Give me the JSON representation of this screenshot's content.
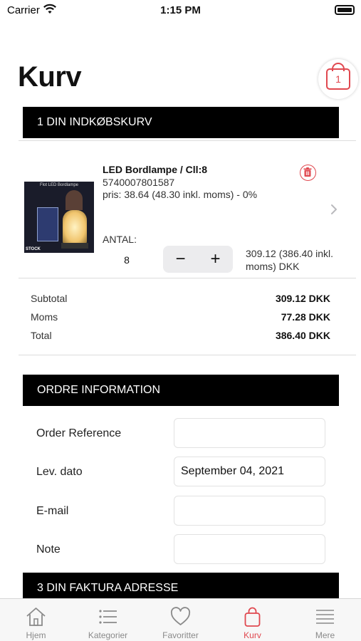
{
  "status_bar": {
    "carrier": "Carrier",
    "time": "1:15 PM"
  },
  "header": {
    "title": "Kurv",
    "cart_count": "1"
  },
  "cart_section": {
    "title": "1  DIN INDKØBSKURV"
  },
  "product": {
    "name": "LED Bordlampe / Cll:8",
    "sku": "5740007801587",
    "price": "pris: 38.64 (48.30 inkl. moms)  -  0%",
    "image_caption": "Flot LED Bordlampe",
    "image_watermark": "STOCK",
    "quantity_label": "ANTAL:",
    "quantity": "8",
    "line_total_line1": "309.12 (386.40 inkl.",
    "line_total_line2": "moms) DKK"
  },
  "totals": {
    "subtotal_label": "Subtotal",
    "subtotal_value": "309.12 DKK",
    "moms_label": "Moms",
    "moms_value": "77.28 DKK",
    "total_label": "Total",
    "total_value": "386.40 DKK"
  },
  "order_section": {
    "title": "ORDRE INFORMATION",
    "fields": {
      "reference_label": "Order Reference",
      "reference_value": "",
      "date_label": "Lev. dato",
      "date_value": "September 04, 2021",
      "email_label": "E-mail",
      "email_value": "",
      "note_label": "Note",
      "note_value": ""
    }
  },
  "invoice_section": {
    "title": "3  DIN FAKTURA ADRESSE"
  },
  "tab_bar": {
    "home": "Hjem",
    "categories": "Kategorier",
    "favorites": "Favoritter",
    "cart": "Kurv",
    "more": "Mere"
  },
  "colors": {
    "accent": "#e0484f",
    "section_bar": "#000000",
    "inactive_tab": "#8a8a8a"
  },
  "icons": [
    "wifi-icon",
    "battery-icon",
    "shopping-bag-icon",
    "trash-icon",
    "chevron-right-icon",
    "minus-icon",
    "plus-icon",
    "home-icon",
    "list-icon",
    "heart-icon",
    "menu-icon"
  ]
}
